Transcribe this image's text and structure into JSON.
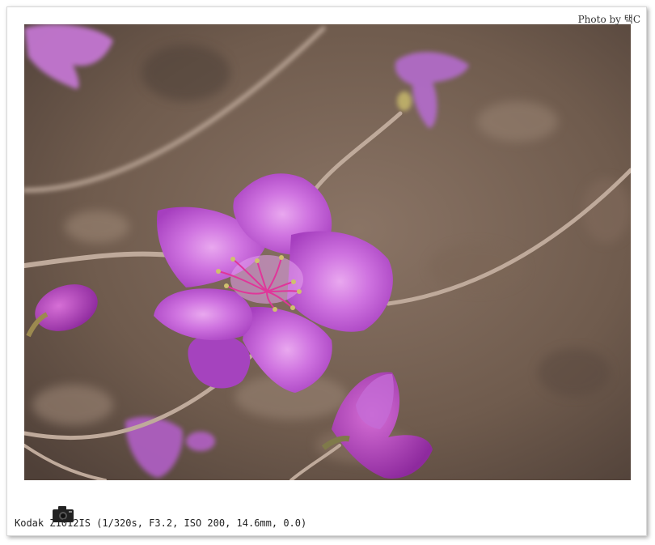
{
  "photo": {
    "subject": "pink azalea flower on bare twigs",
    "colors": {
      "petal": "#c25fd6",
      "petal_light": "#d98ae8",
      "stamen": "#e03a9a",
      "twig": "#b9a393",
      "background": "#6e5a4c"
    }
  },
  "credit": {
    "text": "Photo by 택C"
  },
  "exif": {
    "text": "Kodak Z1012IS (1/320s, F3.2, ISO 200, 14.6mm, 0.0)"
  },
  "icons": {
    "camera": "camera-icon"
  }
}
